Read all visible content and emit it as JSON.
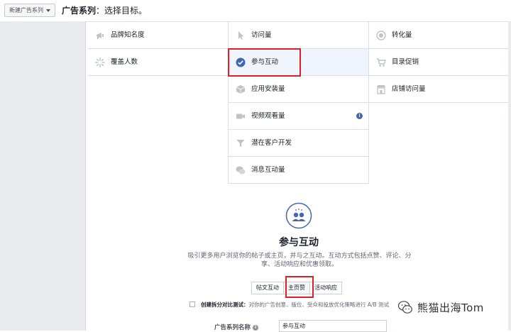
{
  "header": {
    "new_campaign_label": "新建广告系列",
    "title_bold": "广告系列",
    "title_rest": "：选择目标。"
  },
  "objectives": {
    "col1": [
      {
        "label": "品牌知名度",
        "icon": "megaphone-icon"
      },
      {
        "label": "覆盖人数",
        "icon": "reach-burst-icon"
      }
    ],
    "col2": [
      {
        "label": "访问量",
        "icon": "cursor-icon"
      },
      {
        "label": "参与互动",
        "icon": "check-circle-icon",
        "selected": true
      },
      {
        "label": "应用安装量",
        "icon": "box-icon"
      },
      {
        "label": "视频观看量",
        "icon": "video-camera-icon",
        "info": "i"
      },
      {
        "label": "潜在客户开发",
        "icon": "funnel-icon"
      },
      {
        "label": "消息互动量",
        "icon": "chat-bubbles-icon"
      }
    ],
    "col3": [
      {
        "label": "转化量",
        "icon": "globe-icon"
      },
      {
        "label": "目录促销",
        "icon": "shopping-cart-icon"
      },
      {
        "label": "店铺访问量",
        "icon": "store-icon"
      }
    ]
  },
  "detail": {
    "title": "参与互动",
    "description": "吸引更多用户浏览你的帖子或主页，并与之互动。互动方式包括点赞、评论、分享、活动响应和优惠领取。",
    "options": [
      "帖文互动",
      "主页赞",
      "活动响应"
    ],
    "selected_option": "主页赞"
  },
  "split_test": {
    "label": "创建拆分对比测试：",
    "text": "对你的广告创意、版位、受众和投放优化策略进行 A/B 测试"
  },
  "campaign_name": {
    "label": "广告系列名称",
    "value": "参与互动"
  },
  "watermark": {
    "text": "熊猫出海Tom"
  },
  "colors": {
    "accent": "#4267b2",
    "highlight_red": "#e21f26",
    "selected_bg": "#f0f5fd",
    "page_gray": "#e9ebee"
  }
}
